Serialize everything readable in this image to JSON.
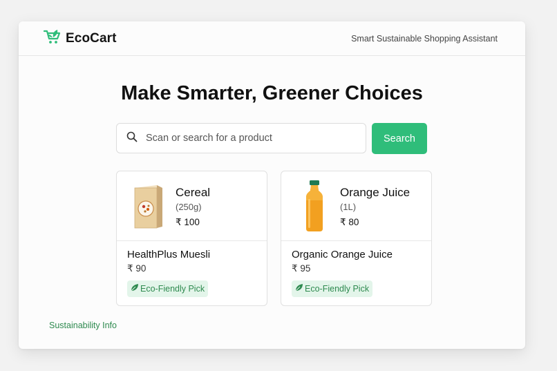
{
  "app": {
    "name": "EcoCart",
    "tagline": "Smart Sustainable Shopping Assistant",
    "brand_color": "#2fbd7a"
  },
  "hero": {
    "title": "Make Smarter, Greener Choices"
  },
  "search": {
    "placeholder": "Scan or search for a product",
    "button_label": "Search"
  },
  "products": [
    {
      "icon": "cereal-box-icon",
      "name": "Cereal",
      "size": "(250g)",
      "price": "₹ 100",
      "alternative": {
        "name": "HealthPlus Muesli",
        "price": "₹ 90",
        "badge_icon": "leaf-icon",
        "badge": "Eco-Fiendly Pick"
      }
    },
    {
      "icon": "juice-bottle-icon",
      "name": "Orange Juice",
      "size": "(1L)",
      "price": "₹ 80",
      "alternative": {
        "name": "Organic Orange Juice",
        "price": "₹ 95",
        "badge_icon": "leaf-icon",
        "badge": "Eco-Fiendly Pick"
      }
    }
  ],
  "footer": {
    "link": "Sustainability Info"
  }
}
